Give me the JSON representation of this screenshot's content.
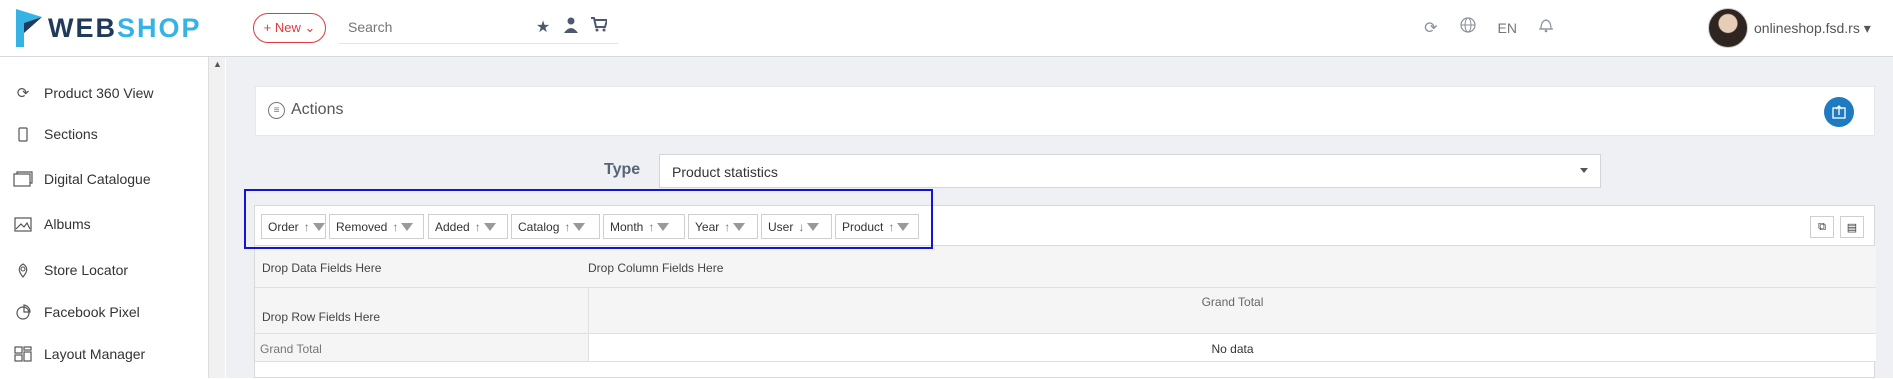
{
  "app": {
    "logo_part1": "WEB",
    "logo_part2": "SHOP",
    "new_button": "+ New ⌄",
    "search_placeholder": "Search",
    "language": "EN",
    "user_name": "onlineshop.fsd.rs ▾"
  },
  "sidebar": {
    "items": [
      {
        "label": "Product 360 View",
        "icon": "sync-icon"
      },
      {
        "label": "Sections",
        "icon": "mobile-icon"
      },
      {
        "label": "Digital Catalogue",
        "icon": "catalogue-icon"
      },
      {
        "label": "Albums",
        "icon": "image-icon"
      },
      {
        "label": "Store Locator",
        "icon": "map-pin-icon"
      },
      {
        "label": "Facebook Pixel",
        "icon": "pie-chart-icon"
      },
      {
        "label": "Layout Manager",
        "icon": "layout-icon"
      }
    ]
  },
  "actions": {
    "title": "Actions"
  },
  "type_selector": {
    "label": "Type",
    "value": "Product statistics"
  },
  "pivot": {
    "fields": [
      {
        "label": "Order",
        "sort": "↑"
      },
      {
        "label": "Removed",
        "sort": "↑"
      },
      {
        "label": "Added",
        "sort": "↑"
      },
      {
        "label": "Catalog",
        "sort": "↑"
      },
      {
        "label": "Month",
        "sort": "↑"
      },
      {
        "label": "Year",
        "sort": "↑"
      },
      {
        "label": "User",
        "sort": "↓"
      },
      {
        "label": "Product",
        "sort": "↑"
      }
    ],
    "data_drop": "Drop Data Fields Here",
    "column_drop": "Drop Column Fields Here",
    "row_drop": "Drop Row Fields Here",
    "column_grand_total": "Grand Total",
    "row_grand_total": "Grand Total",
    "no_data": "No data"
  },
  "colors": {
    "accent_blue": "#1e7bc1",
    "new_red": "#e0393e",
    "highlight": "#1414d6"
  }
}
